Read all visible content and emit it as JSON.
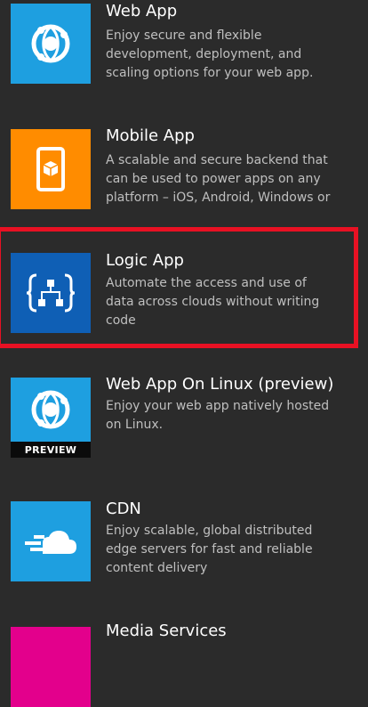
{
  "colors": {
    "blue": "#1e9fe0",
    "orange": "#ff8c00",
    "navy": "#0f5fb5",
    "magenta": "#e3008c",
    "highlight": "#e81123",
    "background": "#2b2b2b"
  },
  "items": [
    {
      "title": "Web App",
      "description": "Enjoy secure and flexible\ndevelopment, deployment, and\nscaling options for your web app.",
      "icon": "globe-icon"
    },
    {
      "title": "Mobile App",
      "description": "A scalable and secure backend that\ncan be used to power apps on any\nplatform – iOS, Android, Windows or",
      "icon": "mobile-box-icon"
    },
    {
      "title": "Logic App",
      "description": "Automate the access and use of\ndata across clouds without writing\ncode",
      "icon": "logic-app-icon"
    },
    {
      "title": "Web App On Linux (preview)",
      "description": "Enjoy your web app natively hosted\non Linux.",
      "icon": "globe-icon",
      "badge": "PREVIEW"
    },
    {
      "title": "CDN",
      "description": "Enjoy scalable, global distributed\nedge servers for fast and reliable\ncontent delivery",
      "icon": "cloud-icon"
    },
    {
      "title": "Media Services",
      "description": "",
      "icon": "media-icon"
    }
  ]
}
